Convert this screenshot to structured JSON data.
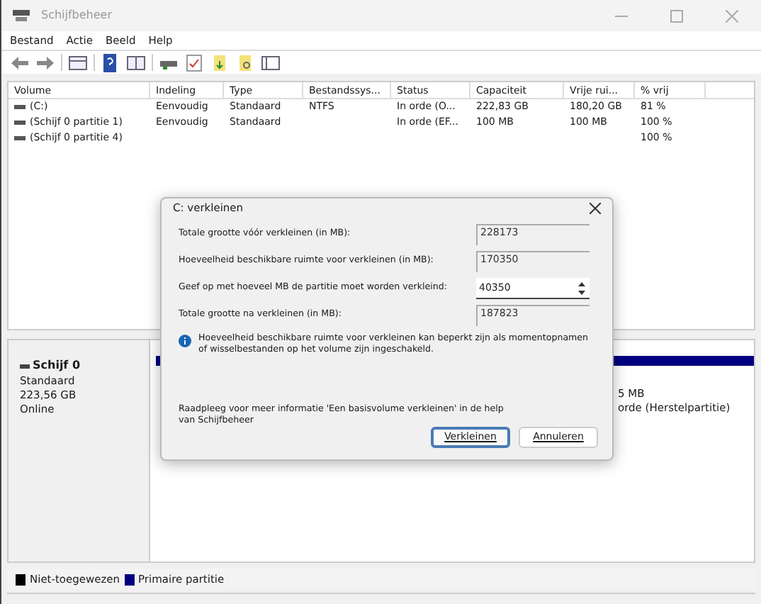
{
  "window": {
    "title": "Schijfbeheer"
  },
  "menu": [
    "Bestand",
    "Actie",
    "Beeld",
    "Help"
  ],
  "table": {
    "columns": [
      "Volume",
      "Indeling",
      "Type",
      "Bestandssys...",
      "Status",
      "Capaciteit",
      "Vrije rui...",
      "% vrij"
    ],
    "rows": [
      {
        "cells": [
          "(C:)",
          "Eenvoudig",
          "Standaard",
          "NTFS",
          "In orde (O...",
          "222,83 GB",
          "180,20 GB",
          "81 %"
        ]
      },
      {
        "cells": [
          "(Schijf 0 partitie 1)",
          "Eenvoudig",
          "Standaard",
          null,
          "In orde (EF...",
          "100 MB",
          "100 MB",
          "100 %"
        ]
      },
      {
        "cells": [
          "(Schijf 0 partitie 4)",
          null,
          null,
          null,
          null,
          null,
          null,
          "100 %"
        ]
      }
    ]
  },
  "disk": {
    "name": "Schijf 0",
    "lines": [
      "Standaard",
      "223,56 GB",
      "Online"
    ],
    "partition_lines": [
      "5 MB",
      "orde (Herstelpartitie)"
    ]
  },
  "legend": [
    {
      "label": "Niet-toegewezen",
      "color": "#000000"
    },
    {
      "label": "Primaire partitie",
      "color": "#000080"
    }
  ],
  "dialog": {
    "title": "C: verkleinen",
    "fields": [
      {
        "kind": "readonly",
        "label": "Totale grootte vóór verkleinen (in MB):",
        "value": "228173"
      },
      {
        "kind": "readonly",
        "label": "Hoeveelheid beschikbare ruimte voor verkleinen (in MB):",
        "value": "170350"
      },
      {
        "kind": "spin",
        "label": "Geef op met hoeveel MB de partitie moet worden verkleind:",
        "value": "40350"
      },
      {
        "kind": "readonly",
        "label": "Totale grootte na verkleinen (in MB):",
        "value": "187823"
      }
    ],
    "info": "Hoeveelheid beschikbare ruimte voor verkleinen kan beperkt zijn als momentopnamen of wisselbestanden op het volume zijn ingeschakeld.",
    "help": "Raadpleeg voor meer informatie 'Een basisvolume verkleinen' in de help van Schijfbeheer",
    "buttons": [
      {
        "label": "Verkleinen",
        "selected": true
      },
      {
        "label": "Annuleren",
        "selected": false
      }
    ]
  }
}
